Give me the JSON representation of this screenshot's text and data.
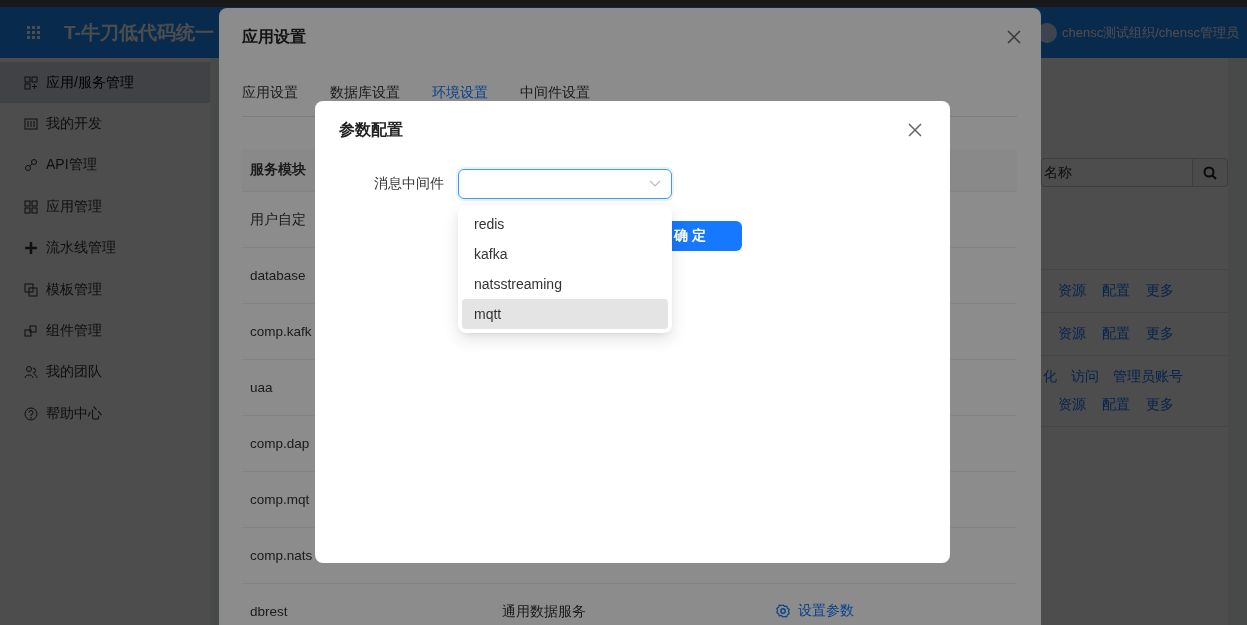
{
  "header": {
    "title": "T-牛刀低代码统一",
    "user": "chensc测试组织/chensc管理员"
  },
  "sidebar": {
    "items": [
      {
        "label": "应用/服务管理",
        "selected": true
      },
      {
        "label": "我的开发",
        "selected": false
      },
      {
        "label": "API管理",
        "selected": false
      },
      {
        "label": "应用管理",
        "selected": false
      },
      {
        "label": "流水线管理",
        "selected": false
      },
      {
        "label": "模板管理",
        "selected": false
      },
      {
        "label": "组件管理",
        "selected": false
      },
      {
        "label": "我的团队",
        "selected": false
      },
      {
        "label": "帮助中心",
        "selected": false
      }
    ]
  },
  "main": {
    "search": {
      "placeholder": "名称"
    },
    "rows": [
      {
        "lines": [
          [
            "资源",
            "配置",
            "更多"
          ]
        ]
      },
      {
        "lines": [
          [
            "资源",
            "配置",
            "更多"
          ]
        ]
      },
      {
        "lines": [
          [
            "化",
            "访问",
            "管理员账号"
          ],
          [
            "资源",
            "配置",
            "更多"
          ]
        ]
      }
    ]
  },
  "drawer": {
    "title": "应用设置",
    "tabs": [
      {
        "label": "应用设置",
        "selected": false
      },
      {
        "label": "数据库设置",
        "selected": false
      },
      {
        "label": "环境设置",
        "selected": true
      },
      {
        "label": "中间件设置",
        "selected": false
      }
    ],
    "table": {
      "columns": [
        "服务模块"
      ],
      "rows": [
        {
          "cells": [
            "用户自定"
          ]
        },
        {
          "cells": [
            "database"
          ]
        },
        {
          "cells": [
            "comp.kafk"
          ]
        },
        {
          "cells": [
            "uaa"
          ]
        },
        {
          "cells": [
            "comp.dap"
          ]
        },
        {
          "cells": [
            "comp.mqt"
          ]
        },
        {
          "cells": [
            "comp.nats"
          ]
        },
        {
          "cells": [
            "dbrest",
            "通用数据服务"
          ],
          "action": "设置参数"
        }
      ]
    }
  },
  "dialog": {
    "title": "参数配置",
    "field": {
      "label": "消息中间件",
      "focused": true,
      "open": true,
      "options": [
        {
          "label": "redis",
          "highlighted": false
        },
        {
          "label": "kafka",
          "highlighted": false
        },
        {
          "label": "natsstreaming",
          "highlighted": false
        },
        {
          "label": "mqtt",
          "highlighted": true
        }
      ]
    },
    "confirm": "确 定"
  }
}
